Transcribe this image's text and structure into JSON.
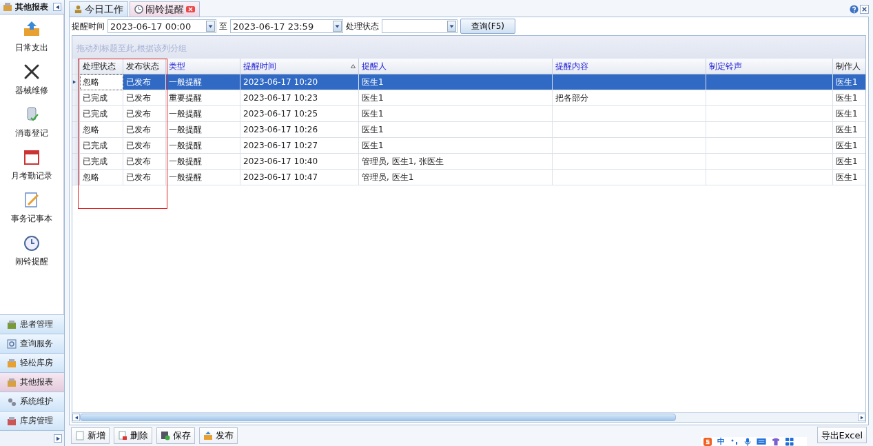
{
  "sidebar": {
    "title": "其他报表",
    "items": [
      {
        "label": "日常支出"
      },
      {
        "label": "器械维修"
      },
      {
        "label": "消毒登记"
      },
      {
        "label": "月考勤记录"
      },
      {
        "label": "事务记事本"
      },
      {
        "label": "闹铃提醒"
      }
    ],
    "nav": [
      {
        "label": "患者管理",
        "selected": false
      },
      {
        "label": "查询服务",
        "selected": false
      },
      {
        "label": "轻松库房",
        "selected": false
      },
      {
        "label": "其他报表",
        "selected": true
      },
      {
        "label": "系统维护",
        "selected": false
      },
      {
        "label": "库房管理",
        "selected": false
      }
    ]
  },
  "tabs": [
    {
      "label": "今日工作",
      "selected": false,
      "closable": false
    },
    {
      "label": "闹铃提醒",
      "selected": true,
      "closable": true
    }
  ],
  "filters": {
    "time_label": "提醒时间",
    "from": "2023-06-17 00:00",
    "to_label": "至",
    "to": "2023-06-17 23:59",
    "status_label": "处理状态",
    "query_button": "查询(F5)"
  },
  "group_hint": "拖动列标题至此,根据该列分组",
  "table": {
    "columns": [
      {
        "label": "处理状态",
        "linked": false,
        "sorted": false
      },
      {
        "label": "发布状态",
        "linked": false,
        "sorted": false
      },
      {
        "label": "类型",
        "linked": true,
        "sorted": false
      },
      {
        "label": "提醒时间",
        "linked": true,
        "sorted": true
      },
      {
        "label": "提醒人",
        "linked": true,
        "sorted": false
      },
      {
        "label": "提醒内容",
        "linked": true,
        "sorted": false
      },
      {
        "label": "制定铃声",
        "linked": true,
        "sorted": false
      },
      {
        "label": "制作人",
        "linked": false,
        "sorted": false
      }
    ],
    "rows": [
      {
        "selected": true,
        "cells": [
          "忽略",
          "已发布",
          "一般提醒",
          "2023-06-17 10:20",
          "医生1",
          "",
          "",
          "医生1"
        ]
      },
      {
        "selected": false,
        "cells": [
          "已完成",
          "已发布",
          "重要提醒",
          "2023-06-17 10:23",
          "医生1",
          "把各部分",
          "",
          "医生1"
        ]
      },
      {
        "selected": false,
        "cells": [
          "已完成",
          "已发布",
          "一般提醒",
          "2023-06-17 10:25",
          "医生1",
          "",
          "",
          "医生1"
        ]
      },
      {
        "selected": false,
        "cells": [
          "忽略",
          "已发布",
          "一般提醒",
          "2023-06-17 10:26",
          "医生1",
          "",
          "",
          "医生1"
        ]
      },
      {
        "selected": false,
        "cells": [
          "已完成",
          "已发布",
          "一般提醒",
          "2023-06-17 10:27",
          "医生1",
          "",
          "",
          "医生1"
        ]
      },
      {
        "selected": false,
        "cells": [
          "已完成",
          "已发布",
          "一般提醒",
          "2023-06-17 10:40",
          "管理员, 医生1, 张医生",
          "",
          "",
          "医生1"
        ]
      },
      {
        "selected": false,
        "cells": [
          "忽略",
          "已发布",
          "一般提醒",
          "2023-06-17 10:47",
          "管理员, 医生1",
          "",
          "",
          "医生1"
        ]
      }
    ]
  },
  "toolbar": [
    {
      "label": "新增"
    },
    {
      "label": "删除"
    },
    {
      "label": "保存"
    },
    {
      "label": "发布"
    }
  ],
  "export_button": "导出Excel",
  "ime": {
    "mode": "中"
  }
}
